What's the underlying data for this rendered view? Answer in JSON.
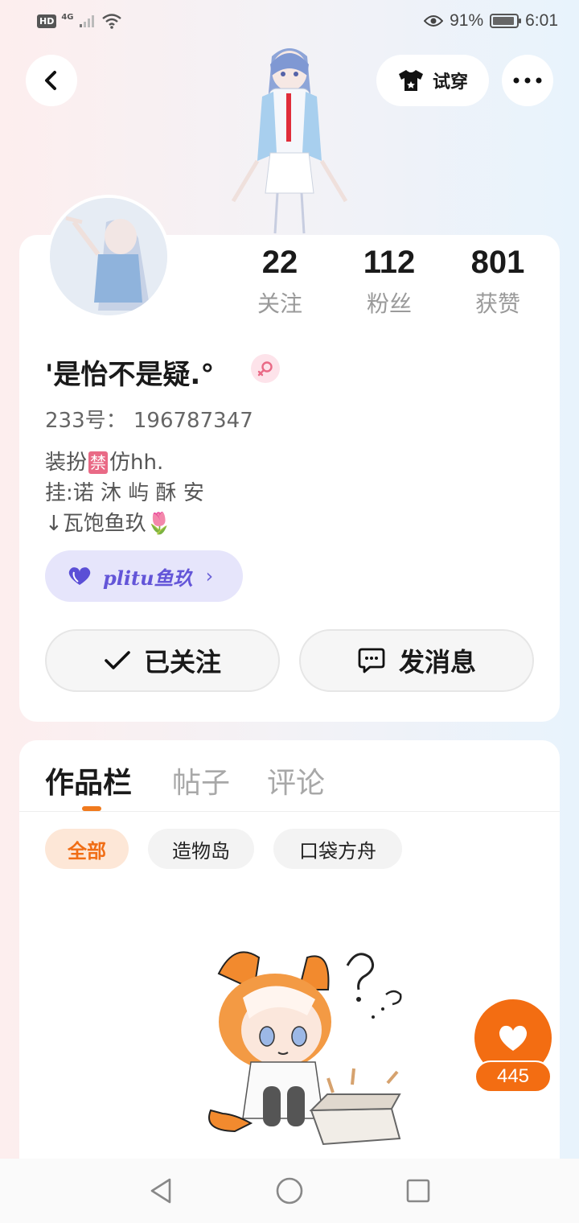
{
  "status_bar": {
    "hd": "HD",
    "network": "4G",
    "battery_percent": "91%",
    "time": "6:01"
  },
  "header": {
    "try_on_label": "试穿",
    "icons": [
      "back-icon",
      "tshirt-icon",
      "more-icon"
    ]
  },
  "profile": {
    "stats": [
      {
        "value": "22",
        "label": "关注"
      },
      {
        "value": "112",
        "label": "粉丝"
      },
      {
        "value": "801",
        "label": "获赞"
      }
    ],
    "username": "'是怡不是疑.°",
    "gender_icon": "female-icon",
    "uid": "233号： 196787347",
    "bio": {
      "line1_prefix": "装扮",
      "line1_badge": "禁",
      "line1_suffix": "仿hh.",
      "line2": "挂:诺 沐 屿 酥 安",
      "line3": "↓瓦饱鱼玖",
      "line3_emoji": "🌷"
    },
    "club": {
      "name": "plitu鱼玖",
      "arrow": "›"
    },
    "follow_button": "已关注",
    "message_button": "发消息"
  },
  "works": {
    "tabs": [
      "作品栏",
      "帖子",
      "评论"
    ],
    "active_tab": 0,
    "filters": [
      "全部",
      "造物岛",
      "口袋方舟"
    ],
    "active_filter": 0
  },
  "like_fab": {
    "count": "445"
  },
  "colors": {
    "accent": "#f36d12",
    "club": "#6355d8",
    "female": "#e96a86"
  }
}
